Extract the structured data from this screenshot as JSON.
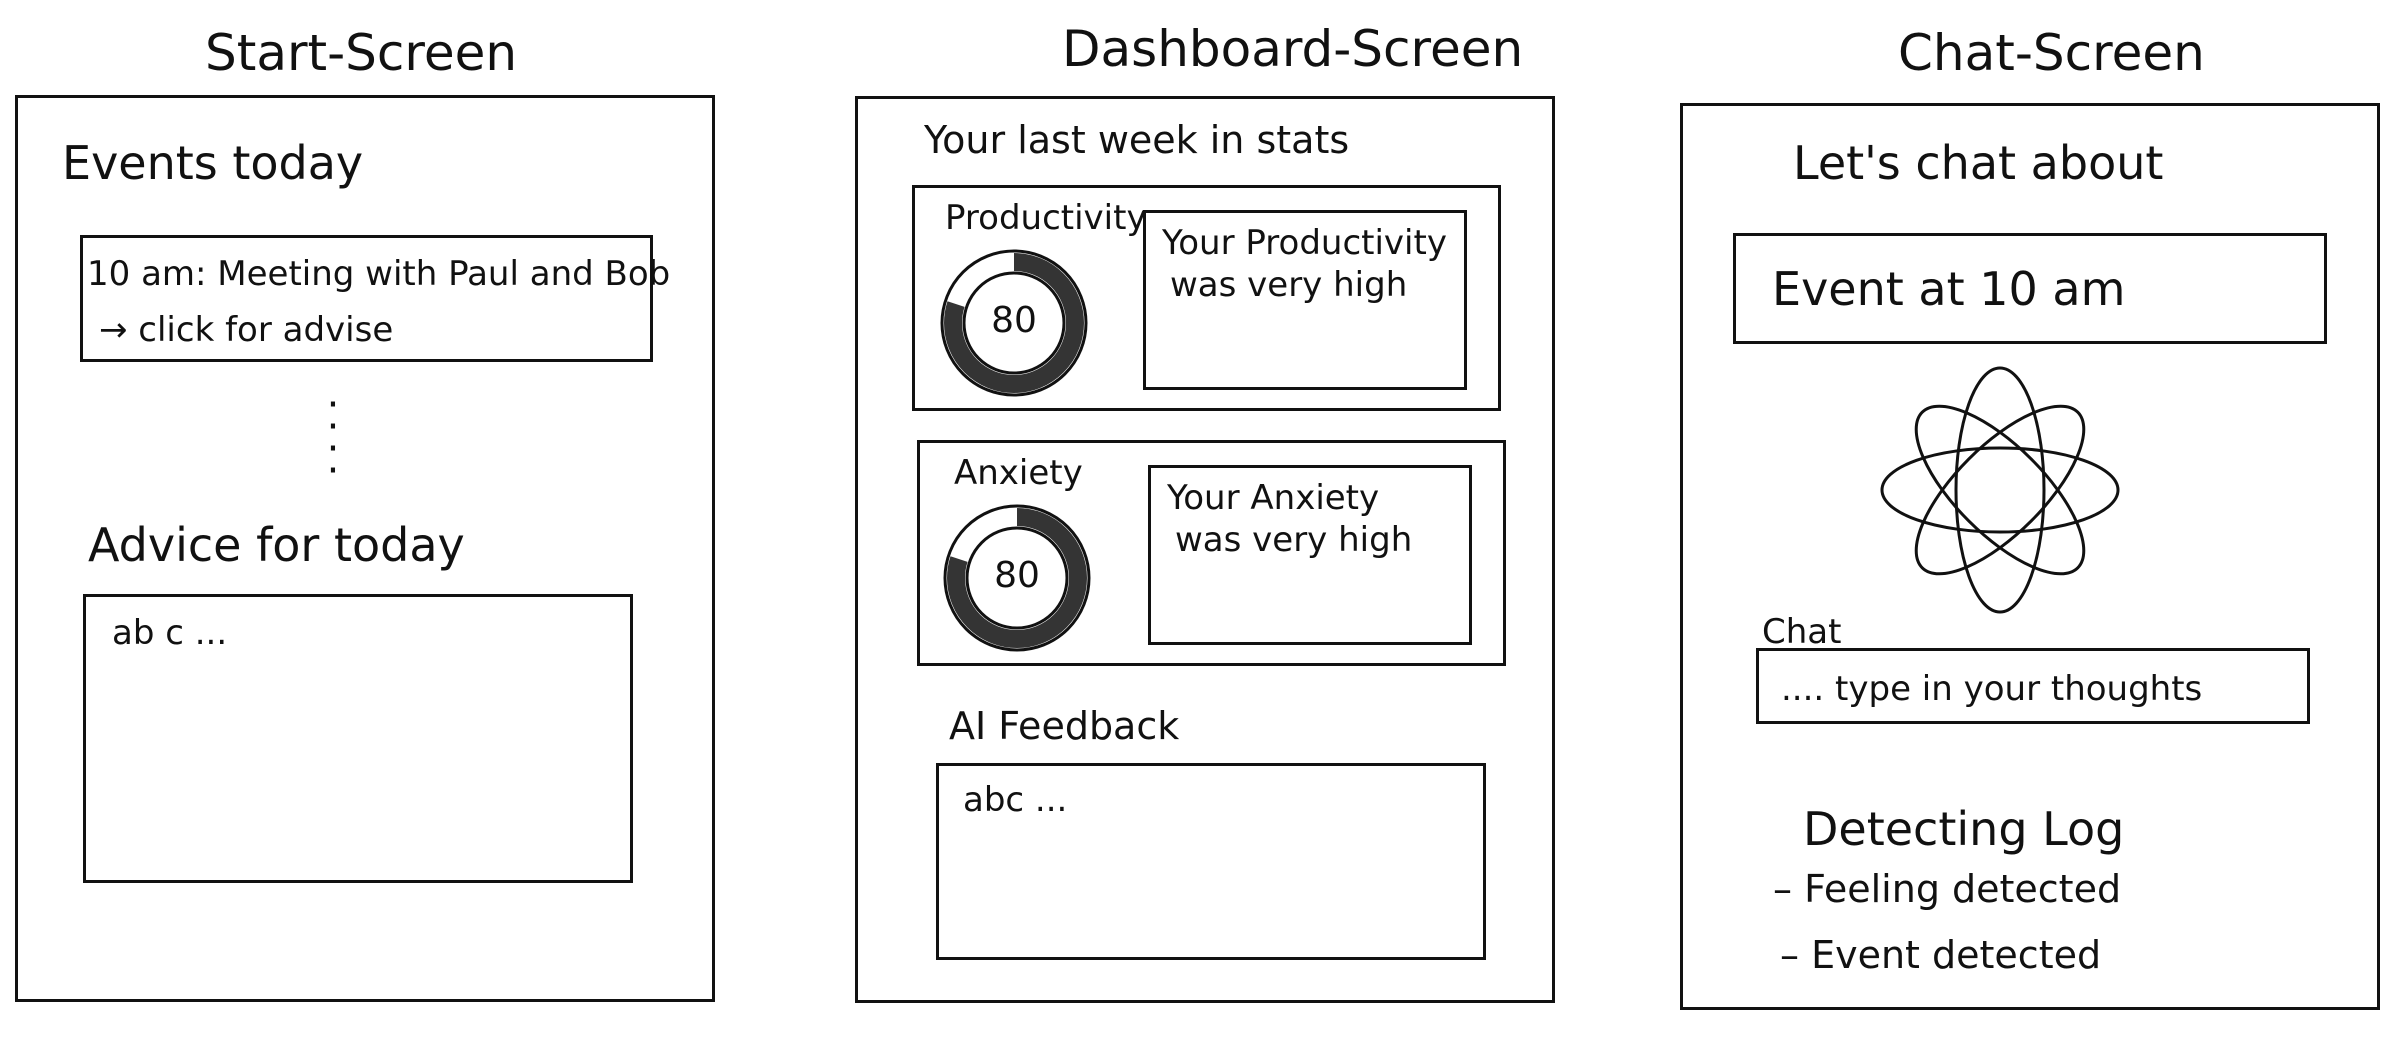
{
  "start_screen": {
    "title": "Start-Screen",
    "events_heading": "Events today",
    "event_card": {
      "line1": "10 am: Meeting with Paul and Bob",
      "line2": "→ click for advise"
    },
    "more_dots": "⋮",
    "advice_heading": "Advice for today",
    "advice_text": "ab c ..."
  },
  "dashboard_screen": {
    "title": "Dashboard-Screen",
    "stats_heading": "Your last week in stats",
    "stats": [
      {
        "label": "Productivity",
        "value": "80",
        "level": 80,
        "text_line1": "Your Productivity",
        "text_line2": "was very high"
      },
      {
        "label": "Anxiety",
        "value": "80",
        "level": 80,
        "text_line1": "Your Anxiety",
        "text_line2": "was very high"
      }
    ],
    "ai_feedback_heading": "AI Feedback",
    "ai_feedback_text": "abc ..."
  },
  "chat_screen": {
    "title": "Chat-Screen",
    "topic_heading": "Let's chat about",
    "topic_value": "Event at 10 am",
    "chat_label": "Chat",
    "chat_placeholder": ".... type in your thoughts",
    "log_heading": "Detecting Log",
    "log_items": [
      "– Feeling detected",
      "– Event detected"
    ]
  },
  "icons": {
    "gauge": "progress-ring-icon",
    "orbit": "atom-orbit-icon"
  }
}
